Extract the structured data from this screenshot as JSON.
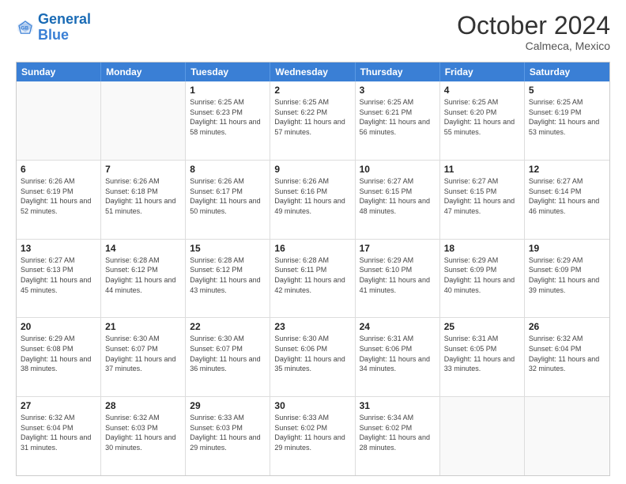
{
  "header": {
    "logo_line1": "General",
    "logo_line2": "Blue",
    "month": "October 2024",
    "location": "Calmeca, Mexico"
  },
  "weekdays": [
    "Sunday",
    "Monday",
    "Tuesday",
    "Wednesday",
    "Thursday",
    "Friday",
    "Saturday"
  ],
  "rows": [
    [
      {
        "day": "",
        "sunrise": "",
        "sunset": "",
        "daylight": "",
        "empty": true
      },
      {
        "day": "",
        "sunrise": "",
        "sunset": "",
        "daylight": "",
        "empty": true
      },
      {
        "day": "1",
        "sunrise": "Sunrise: 6:25 AM",
        "sunset": "Sunset: 6:23 PM",
        "daylight": "Daylight: 11 hours and 58 minutes."
      },
      {
        "day": "2",
        "sunrise": "Sunrise: 6:25 AM",
        "sunset": "Sunset: 6:22 PM",
        "daylight": "Daylight: 11 hours and 57 minutes."
      },
      {
        "day": "3",
        "sunrise": "Sunrise: 6:25 AM",
        "sunset": "Sunset: 6:21 PM",
        "daylight": "Daylight: 11 hours and 56 minutes."
      },
      {
        "day": "4",
        "sunrise": "Sunrise: 6:25 AM",
        "sunset": "Sunset: 6:20 PM",
        "daylight": "Daylight: 11 hours and 55 minutes."
      },
      {
        "day": "5",
        "sunrise": "Sunrise: 6:25 AM",
        "sunset": "Sunset: 6:19 PM",
        "daylight": "Daylight: 11 hours and 53 minutes."
      }
    ],
    [
      {
        "day": "6",
        "sunrise": "Sunrise: 6:26 AM",
        "sunset": "Sunset: 6:19 PM",
        "daylight": "Daylight: 11 hours and 52 minutes."
      },
      {
        "day": "7",
        "sunrise": "Sunrise: 6:26 AM",
        "sunset": "Sunset: 6:18 PM",
        "daylight": "Daylight: 11 hours and 51 minutes."
      },
      {
        "day": "8",
        "sunrise": "Sunrise: 6:26 AM",
        "sunset": "Sunset: 6:17 PM",
        "daylight": "Daylight: 11 hours and 50 minutes."
      },
      {
        "day": "9",
        "sunrise": "Sunrise: 6:26 AM",
        "sunset": "Sunset: 6:16 PM",
        "daylight": "Daylight: 11 hours and 49 minutes."
      },
      {
        "day": "10",
        "sunrise": "Sunrise: 6:27 AM",
        "sunset": "Sunset: 6:15 PM",
        "daylight": "Daylight: 11 hours and 48 minutes."
      },
      {
        "day": "11",
        "sunrise": "Sunrise: 6:27 AM",
        "sunset": "Sunset: 6:15 PM",
        "daylight": "Daylight: 11 hours and 47 minutes."
      },
      {
        "day": "12",
        "sunrise": "Sunrise: 6:27 AM",
        "sunset": "Sunset: 6:14 PM",
        "daylight": "Daylight: 11 hours and 46 minutes."
      }
    ],
    [
      {
        "day": "13",
        "sunrise": "Sunrise: 6:27 AM",
        "sunset": "Sunset: 6:13 PM",
        "daylight": "Daylight: 11 hours and 45 minutes."
      },
      {
        "day": "14",
        "sunrise": "Sunrise: 6:28 AM",
        "sunset": "Sunset: 6:12 PM",
        "daylight": "Daylight: 11 hours and 44 minutes."
      },
      {
        "day": "15",
        "sunrise": "Sunrise: 6:28 AM",
        "sunset": "Sunset: 6:12 PM",
        "daylight": "Daylight: 11 hours and 43 minutes."
      },
      {
        "day": "16",
        "sunrise": "Sunrise: 6:28 AM",
        "sunset": "Sunset: 6:11 PM",
        "daylight": "Daylight: 11 hours and 42 minutes."
      },
      {
        "day": "17",
        "sunrise": "Sunrise: 6:29 AM",
        "sunset": "Sunset: 6:10 PM",
        "daylight": "Daylight: 11 hours and 41 minutes."
      },
      {
        "day": "18",
        "sunrise": "Sunrise: 6:29 AM",
        "sunset": "Sunset: 6:09 PM",
        "daylight": "Daylight: 11 hours and 40 minutes."
      },
      {
        "day": "19",
        "sunrise": "Sunrise: 6:29 AM",
        "sunset": "Sunset: 6:09 PM",
        "daylight": "Daylight: 11 hours and 39 minutes."
      }
    ],
    [
      {
        "day": "20",
        "sunrise": "Sunrise: 6:29 AM",
        "sunset": "Sunset: 6:08 PM",
        "daylight": "Daylight: 11 hours and 38 minutes."
      },
      {
        "day": "21",
        "sunrise": "Sunrise: 6:30 AM",
        "sunset": "Sunset: 6:07 PM",
        "daylight": "Daylight: 11 hours and 37 minutes."
      },
      {
        "day": "22",
        "sunrise": "Sunrise: 6:30 AM",
        "sunset": "Sunset: 6:07 PM",
        "daylight": "Daylight: 11 hours and 36 minutes."
      },
      {
        "day": "23",
        "sunrise": "Sunrise: 6:30 AM",
        "sunset": "Sunset: 6:06 PM",
        "daylight": "Daylight: 11 hours and 35 minutes."
      },
      {
        "day": "24",
        "sunrise": "Sunrise: 6:31 AM",
        "sunset": "Sunset: 6:06 PM",
        "daylight": "Daylight: 11 hours and 34 minutes."
      },
      {
        "day": "25",
        "sunrise": "Sunrise: 6:31 AM",
        "sunset": "Sunset: 6:05 PM",
        "daylight": "Daylight: 11 hours and 33 minutes."
      },
      {
        "day": "26",
        "sunrise": "Sunrise: 6:32 AM",
        "sunset": "Sunset: 6:04 PM",
        "daylight": "Daylight: 11 hours and 32 minutes."
      }
    ],
    [
      {
        "day": "27",
        "sunrise": "Sunrise: 6:32 AM",
        "sunset": "Sunset: 6:04 PM",
        "daylight": "Daylight: 11 hours and 31 minutes."
      },
      {
        "day": "28",
        "sunrise": "Sunrise: 6:32 AM",
        "sunset": "Sunset: 6:03 PM",
        "daylight": "Daylight: 11 hours and 30 minutes."
      },
      {
        "day": "29",
        "sunrise": "Sunrise: 6:33 AM",
        "sunset": "Sunset: 6:03 PM",
        "daylight": "Daylight: 11 hours and 29 minutes."
      },
      {
        "day": "30",
        "sunrise": "Sunrise: 6:33 AM",
        "sunset": "Sunset: 6:02 PM",
        "daylight": "Daylight: 11 hours and 29 minutes."
      },
      {
        "day": "31",
        "sunrise": "Sunrise: 6:34 AM",
        "sunset": "Sunset: 6:02 PM",
        "daylight": "Daylight: 11 hours and 28 minutes."
      },
      {
        "day": "",
        "sunrise": "",
        "sunset": "",
        "daylight": "",
        "empty": true
      },
      {
        "day": "",
        "sunrise": "",
        "sunset": "",
        "daylight": "",
        "empty": true
      }
    ]
  ]
}
